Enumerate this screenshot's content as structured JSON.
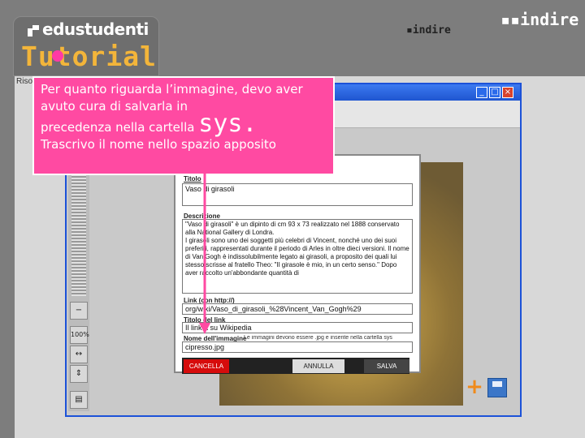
{
  "branding": {
    "product": "edustudenti",
    "tutorial_title": "Tutorial",
    "partner_logo": "indire",
    "colors": {
      "title": "#f3b53a",
      "accent": "#ff3aa5"
    }
  },
  "app": {
    "left_label": "Riso",
    "window_buttons": [
      "_",
      "□",
      "×"
    ],
    "toolbar_logo": "indire",
    "zoom_level": "100%"
  },
  "callout": {
    "line1": "Per quanto riguarda l’immagine, devo aver avuto cura di salvarla in",
    "line2_pre": "precedenza nella cartella",
    "line2_emph": "sys.",
    "line3": "Trascrivo il nome nello spazio apposito",
    "bg_color": "#ff4aa2"
  },
  "form": {
    "titolo_label": "Titolo",
    "titolo_value": "Vaso di girasoli",
    "descrizione_label": "Descrizione",
    "descrizione_value": "\"Vaso di girasoli\" è un dipinto di cm 93 x 73 realizzato nel 1888 conservato alla National Gallery di Londra.\nI girasoli sono uno dei soggetti più celebri di Vincent, nonché uno dei suoi preferiti, rappresentati durante il periodo di Arles in oltre dieci versioni. Il nome di Van Gogh è indissolubilmente legato ai girasoli, a proposito dei quali lui stesso scrisse al fratello Theo: \"Il girasole è mio, in un certo senso.\" Dopo aver raccolto un'abbondante quantità di",
    "link_label": "Link (con http://)",
    "link_value": "org/wiki/Vaso_di_girasoli_%28Vincent_Van_Gogh%29",
    "titolo_link_label": "Titolo del link",
    "titolo_link_value": "Il link a su Wikipedia",
    "nome_immagine_label": "Nome dell'immagine",
    "nome_immagine_hint": "Le immagini devono essere .jpg e inserite nella cartella sys",
    "nome_immagine_value": "cipresso.jpg",
    "cancel_label": "CANCELLA",
    "annulla_label": "ANNULLA",
    "salva_label": "SALVA"
  }
}
